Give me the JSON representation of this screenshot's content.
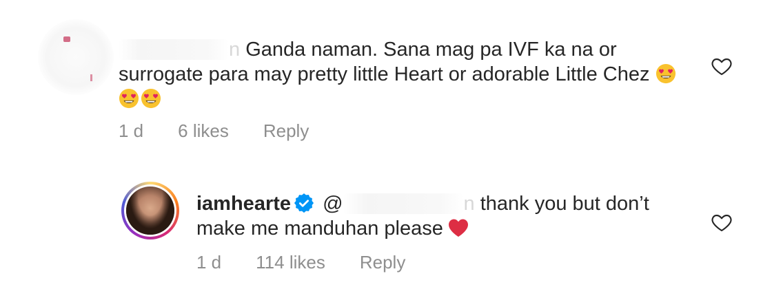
{
  "comments": [
    {
      "text": "Ganda naman. Sana mag pa IVF ka na or surrogate para may pretty little Heart or adorable Little Chez",
      "ghost_char": "n",
      "emojis": [
        "heart-eyes",
        "heart-eyes",
        "heart-eyes"
      ],
      "time": "1 d",
      "likes": "6 likes",
      "reply": "Reply"
    },
    {
      "username": "iamhearte",
      "mention_prefix": "@",
      "ghost_char": "n",
      "text_line1": "thank you but don’t",
      "text_line2": "make me manduhan please",
      "emoji": "red-heart",
      "time": "1 d",
      "likes": "114 likes",
      "reply": "Reply"
    }
  ],
  "colors": {
    "text": "#262626",
    "meta": "#8e8e8e",
    "verified": "#0095f6",
    "heart": "#e0245e"
  }
}
